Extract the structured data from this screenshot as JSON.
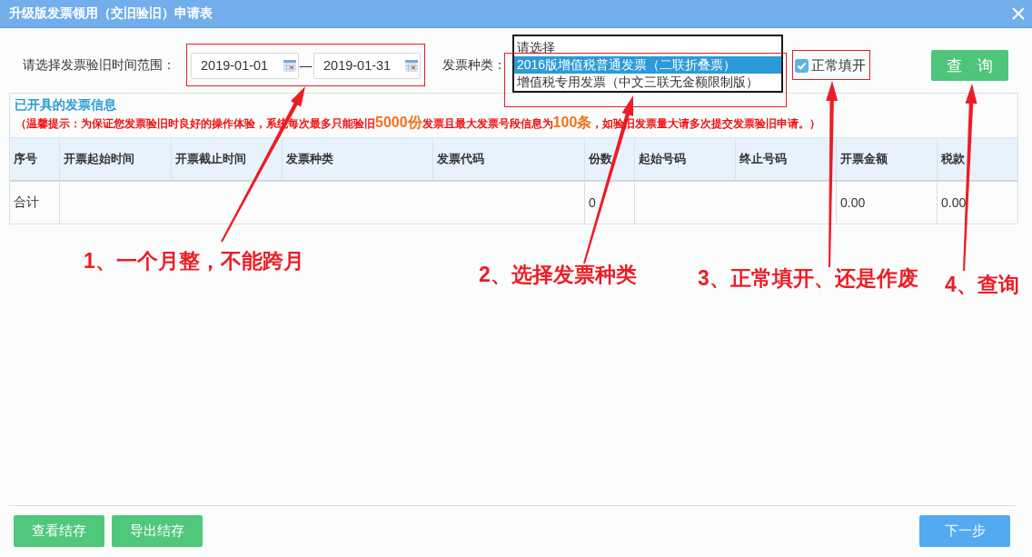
{
  "window": {
    "title": "升级版发票领用（交旧验旧）申请表"
  },
  "filter": {
    "date_range_label": "请选择发票验旧时间范围：",
    "start_date": "2019-01-01",
    "separator": "—",
    "end_date": "2019-01-31",
    "type_label": "发票种类：",
    "type_options": [
      {
        "label": "请选择",
        "selected": false
      },
      {
        "label": "2016版增值税普通发票（二联折叠票）",
        "selected": true
      },
      {
        "label": "增值税专用发票（中文三联无金额限制版）",
        "selected": false
      }
    ],
    "normal_issue": {
      "label": "正常填开",
      "checked": true
    },
    "query_button": "查　询"
  },
  "invoice_panel": {
    "title": "已开具的发票信息",
    "notice": "（温馨提示：为保证您发票验旧时良好的操作体验，系统每次最多只能验旧**5000份**发票且最大发票号段信息为**100条**，如验旧发票量大请多次提交发票验旧申请。）"
  },
  "table": {
    "columns": [
      "序号",
      "开票起始时间",
      "开票截止时间",
      "发票种类",
      "发票代码",
      "份数",
      "起始号码",
      "终止号码",
      "开票金额",
      "税款"
    ],
    "rows": [
      {
        "cells": [
          "合计",
          null,
          null,
          null,
          null,
          "0",
          null,
          null,
          "0.00",
          "0.00"
        ]
      }
    ]
  },
  "footer": {
    "left_buttons": [
      "查看结存",
      "导出结存"
    ],
    "next_button": "下一步"
  },
  "annotations": [
    {
      "text": "1、一个月整，不能跨月"
    },
    {
      "text": "2、选择发票种类"
    },
    {
      "text": "3、正常填开、还是作废"
    },
    {
      "text": "4、查询"
    }
  ]
}
